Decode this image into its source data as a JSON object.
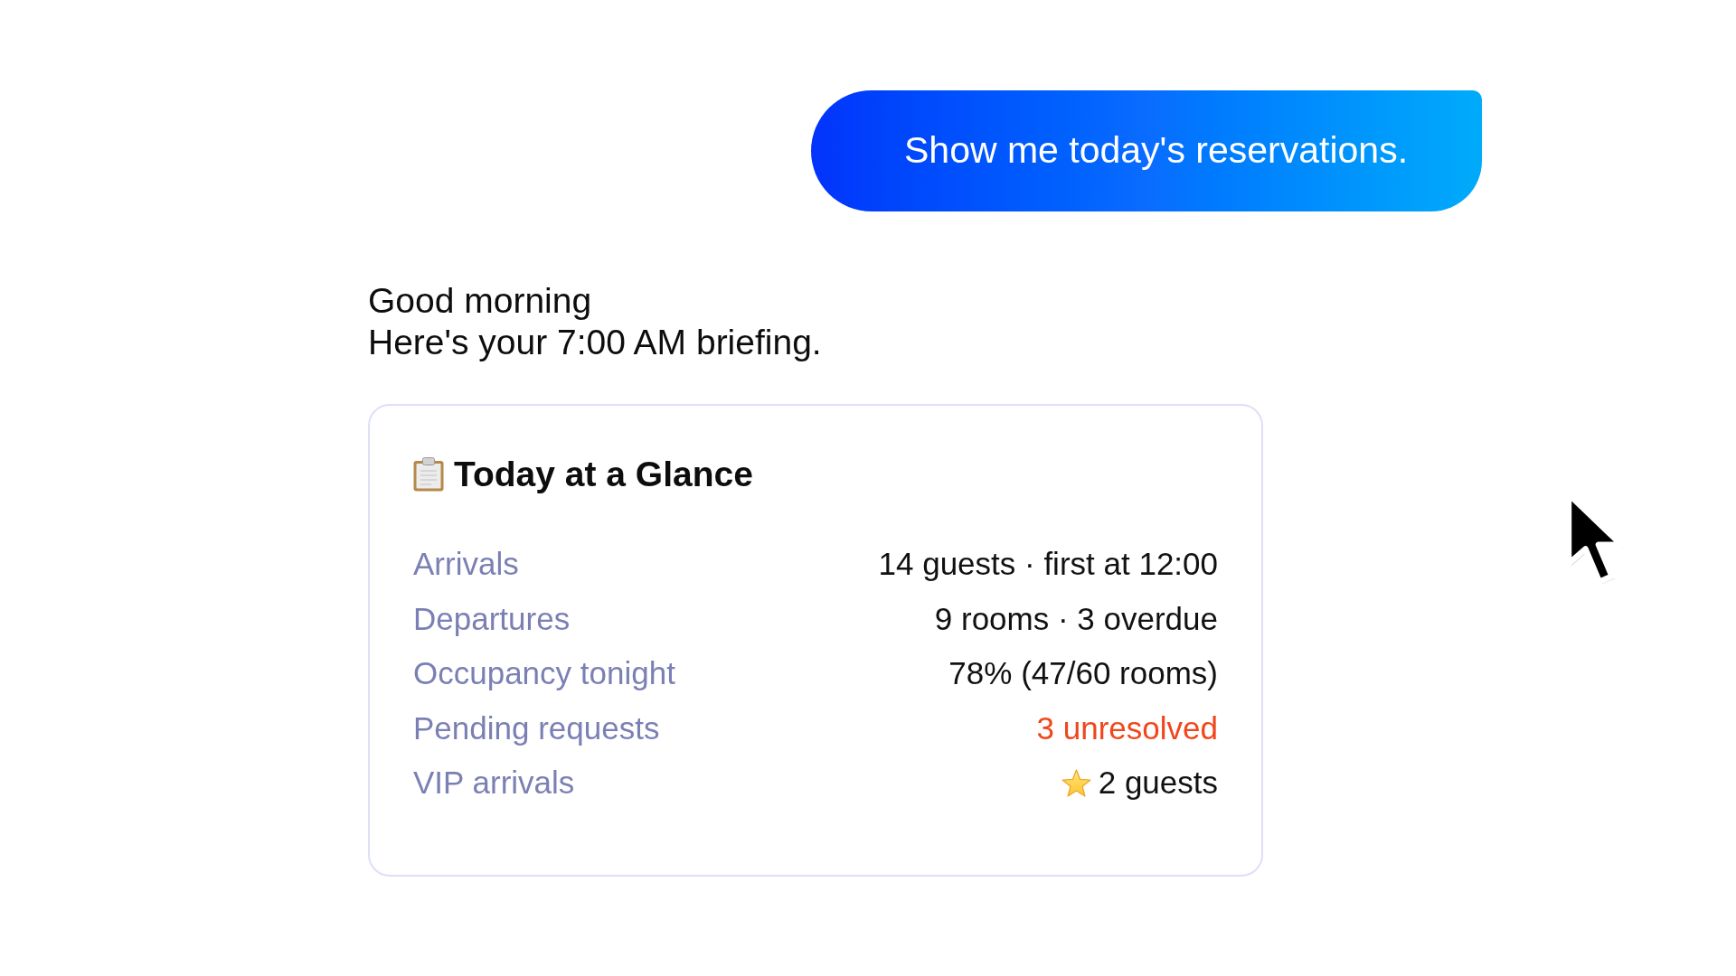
{
  "user_message": {
    "text": "Show me today's reservations."
  },
  "assistant_message": {
    "lines": [
      "Good morning",
      "Here's your 7:00 AM briefing."
    ]
  },
  "summary_card": {
    "title": "Today at a Glance",
    "rows": [
      {
        "label": "Arrivals",
        "value": "14 guests · first at 12:00",
        "kind": "plain"
      },
      {
        "label": "Departures",
        "value": "9 rooms · 3 overdue",
        "kind": "plain"
      },
      {
        "label": "Occupancy tonight",
        "value": "78% (47/60 rooms)",
        "kind": "plain"
      },
      {
        "label": "Pending requests",
        "value": "3 unresolved",
        "kind": "alert"
      },
      {
        "label": "VIP arrivals",
        "value": "2 guests",
        "kind": "vip"
      }
    ]
  }
}
